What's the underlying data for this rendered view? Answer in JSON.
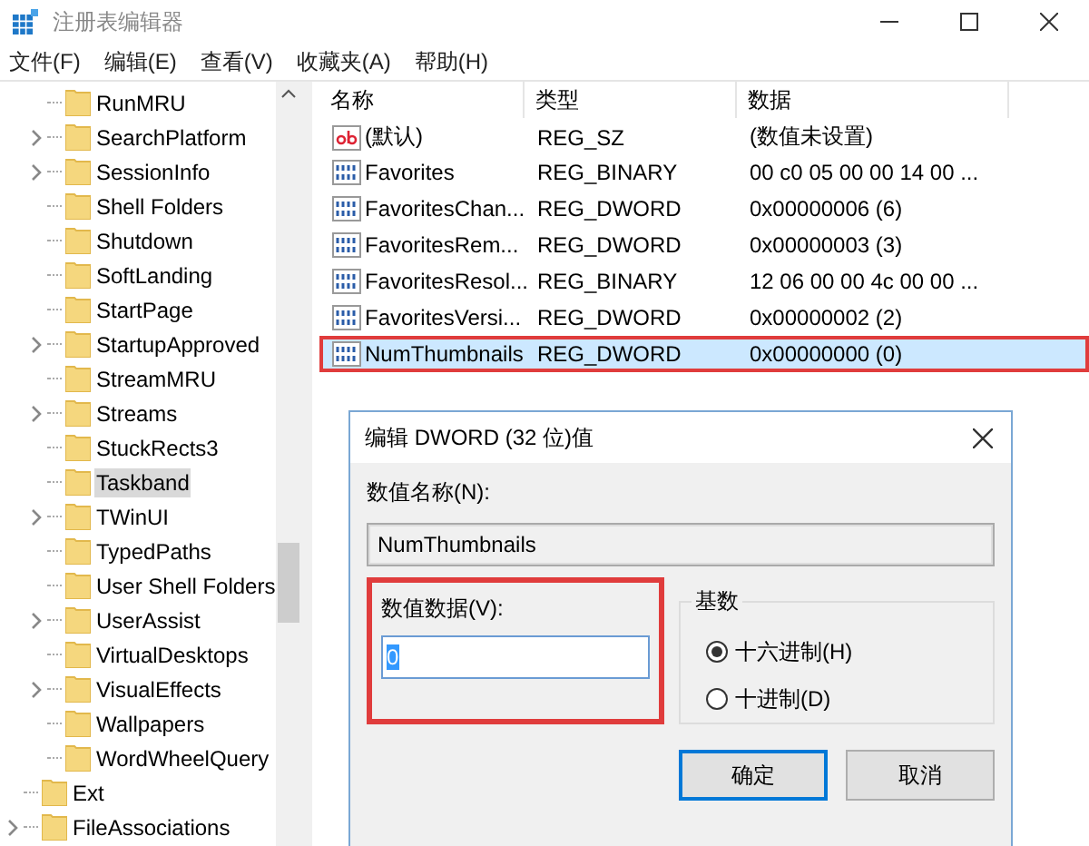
{
  "window": {
    "title": "注册表编辑器"
  },
  "menu": [
    "文件(F)",
    "编辑(E)",
    "查看(V)",
    "收藏夹(A)",
    "帮助(H)"
  ],
  "tree": {
    "branch_items": [
      {
        "label": "RunMRU",
        "expandable": false,
        "selected": false
      },
      {
        "label": "SearchPlatform",
        "expandable": true,
        "selected": false
      },
      {
        "label": "SessionInfo",
        "expandable": true,
        "selected": false
      },
      {
        "label": "Shell Folders",
        "expandable": false,
        "selected": false
      },
      {
        "label": "Shutdown",
        "expandable": false,
        "selected": false
      },
      {
        "label": "SoftLanding",
        "expandable": false,
        "selected": false
      },
      {
        "label": "StartPage",
        "expandable": false,
        "selected": false
      },
      {
        "label": "StartupApproved",
        "expandable": true,
        "selected": false
      },
      {
        "label": "StreamMRU",
        "expandable": false,
        "selected": false
      },
      {
        "label": "Streams",
        "expandable": true,
        "selected": false
      },
      {
        "label": "StuckRects3",
        "expandable": false,
        "selected": false
      },
      {
        "label": "Taskband",
        "expandable": false,
        "selected": true
      },
      {
        "label": "TWinUI",
        "expandable": true,
        "selected": false
      },
      {
        "label": "TypedPaths",
        "expandable": false,
        "selected": false
      },
      {
        "label": "User Shell Folders",
        "expandable": false,
        "selected": false
      },
      {
        "label": "UserAssist",
        "expandable": true,
        "selected": false
      },
      {
        "label": "VirtualDesktops",
        "expandable": false,
        "selected": false
      },
      {
        "label": "VisualEffects",
        "expandable": true,
        "selected": false
      },
      {
        "label": "Wallpapers",
        "expandable": false,
        "selected": false
      },
      {
        "label": "WordWheelQuery",
        "expandable": false,
        "selected": false
      }
    ],
    "items": [
      {
        "label": "Ext",
        "expandable": false,
        "selected": false
      },
      {
        "label": "FileAssociations",
        "expandable": true,
        "selected": false
      }
    ]
  },
  "table": {
    "columns": [
      "名称",
      "类型",
      "数据"
    ],
    "rows": [
      {
        "kind": "string",
        "name": "(默认)",
        "type": "REG_SZ",
        "data": "(数值未设置)",
        "selected": false,
        "highlighted": false
      },
      {
        "kind": "binary",
        "name": "Favorites",
        "type": "REG_BINARY",
        "data": "00 c0 05 00 00 14 00 ...",
        "selected": false,
        "highlighted": false
      },
      {
        "kind": "binary",
        "name": "FavoritesChan...",
        "type": "REG_DWORD",
        "data": "0x00000006 (6)",
        "selected": false,
        "highlighted": false
      },
      {
        "kind": "binary",
        "name": "FavoritesRem...",
        "type": "REG_DWORD",
        "data": "0x00000003 (3)",
        "selected": false,
        "highlighted": false
      },
      {
        "kind": "binary",
        "name": "FavoritesResol...",
        "type": "REG_BINARY",
        "data": "12 06 00 00 4c 00 00 ...",
        "selected": false,
        "highlighted": false
      },
      {
        "kind": "binary",
        "name": "FavoritesVersi...",
        "type": "REG_DWORD",
        "data": "0x00000002 (2)",
        "selected": false,
        "highlighted": false
      },
      {
        "kind": "binary",
        "name": "NumThumbnails",
        "type": "REG_DWORD",
        "data": "0x00000000 (0)",
        "selected": true,
        "highlighted": true
      }
    ]
  },
  "dialog": {
    "title": "编辑 DWORD (32 位)值",
    "name_label": "数值名称(N):",
    "name_value": "NumThumbnails",
    "data_label": "数值数据(V):",
    "data_value": "0",
    "data_highlighted": true,
    "base_label": "基数",
    "radios": [
      {
        "label": "十六进制(H)",
        "selected": true
      },
      {
        "label": "十进制(D)",
        "selected": false
      }
    ],
    "buttons": [
      {
        "label": "确定",
        "default": true
      },
      {
        "label": "取消",
        "default": false
      }
    ]
  }
}
